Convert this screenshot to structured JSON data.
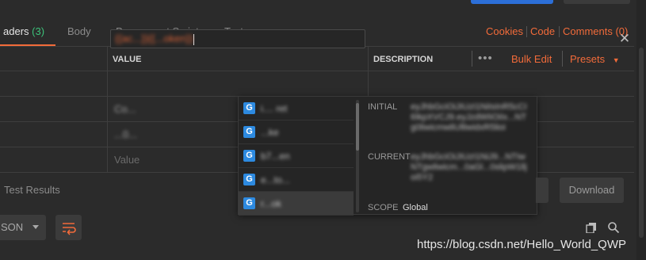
{
  "tabs": {
    "headers": {
      "label": "aders",
      "count": "(3)"
    },
    "body": "Body",
    "prerequest": "Pre-request Script",
    "tests": "Tests"
  },
  "right_links": {
    "cookies": "Cookies",
    "code": "Code",
    "comments": "Comments (0)"
  },
  "table": {
    "col_value": "VALUE",
    "col_description": "DESCRIPTION",
    "bulk_edit": "Bulk Edit",
    "presets": "Presets",
    "rows": [
      {
        "value": "{{ac...}}{{...oken}}"
      },
      {
        "value": "Co..."
      },
      {
        "value": "...0..."
      },
      {
        "value_placeholder": "Value"
      }
    ]
  },
  "autocomplete": {
    "items": [
      {
        "badge": "G",
        "label": "i.... ret"
      },
      {
        "badge": "G",
        "label": "...ke"
      },
      {
        "badge": "G",
        "label": "b7...en"
      },
      {
        "badge": "G",
        "label": "e...to..."
      },
      {
        "badge": "G",
        "label": "r...ok"
      }
    ],
    "selected_index": 4,
    "detail": {
      "initial_label": "INITIAL",
      "initial_value": "eyJhbGciOiJIUzI1NiIsInR5cCI6IkpXVCJ9.eyJzdWIiOiIx...NTg0liwicmwliUlliwidxR5lioi",
      "current_label": "CURRENT",
      "current_value": "eyJhbGciOiJIUzI1NiJ9...NTIwNTgwliwicm...0aGl...0slipW1lljoi5Y2",
      "scope_label": "SCOPE",
      "scope_value": "Global"
    }
  },
  "response": {
    "test_results": "Test Results",
    "download": "Download",
    "format": "SON"
  },
  "watermark": "https://blog.csdn.net/Hello_World_QWP",
  "colors": {
    "accent": "#f26b3a",
    "blue": "#2d8ae0",
    "green": "#3cc27a",
    "bg": "#2b2b2b"
  }
}
